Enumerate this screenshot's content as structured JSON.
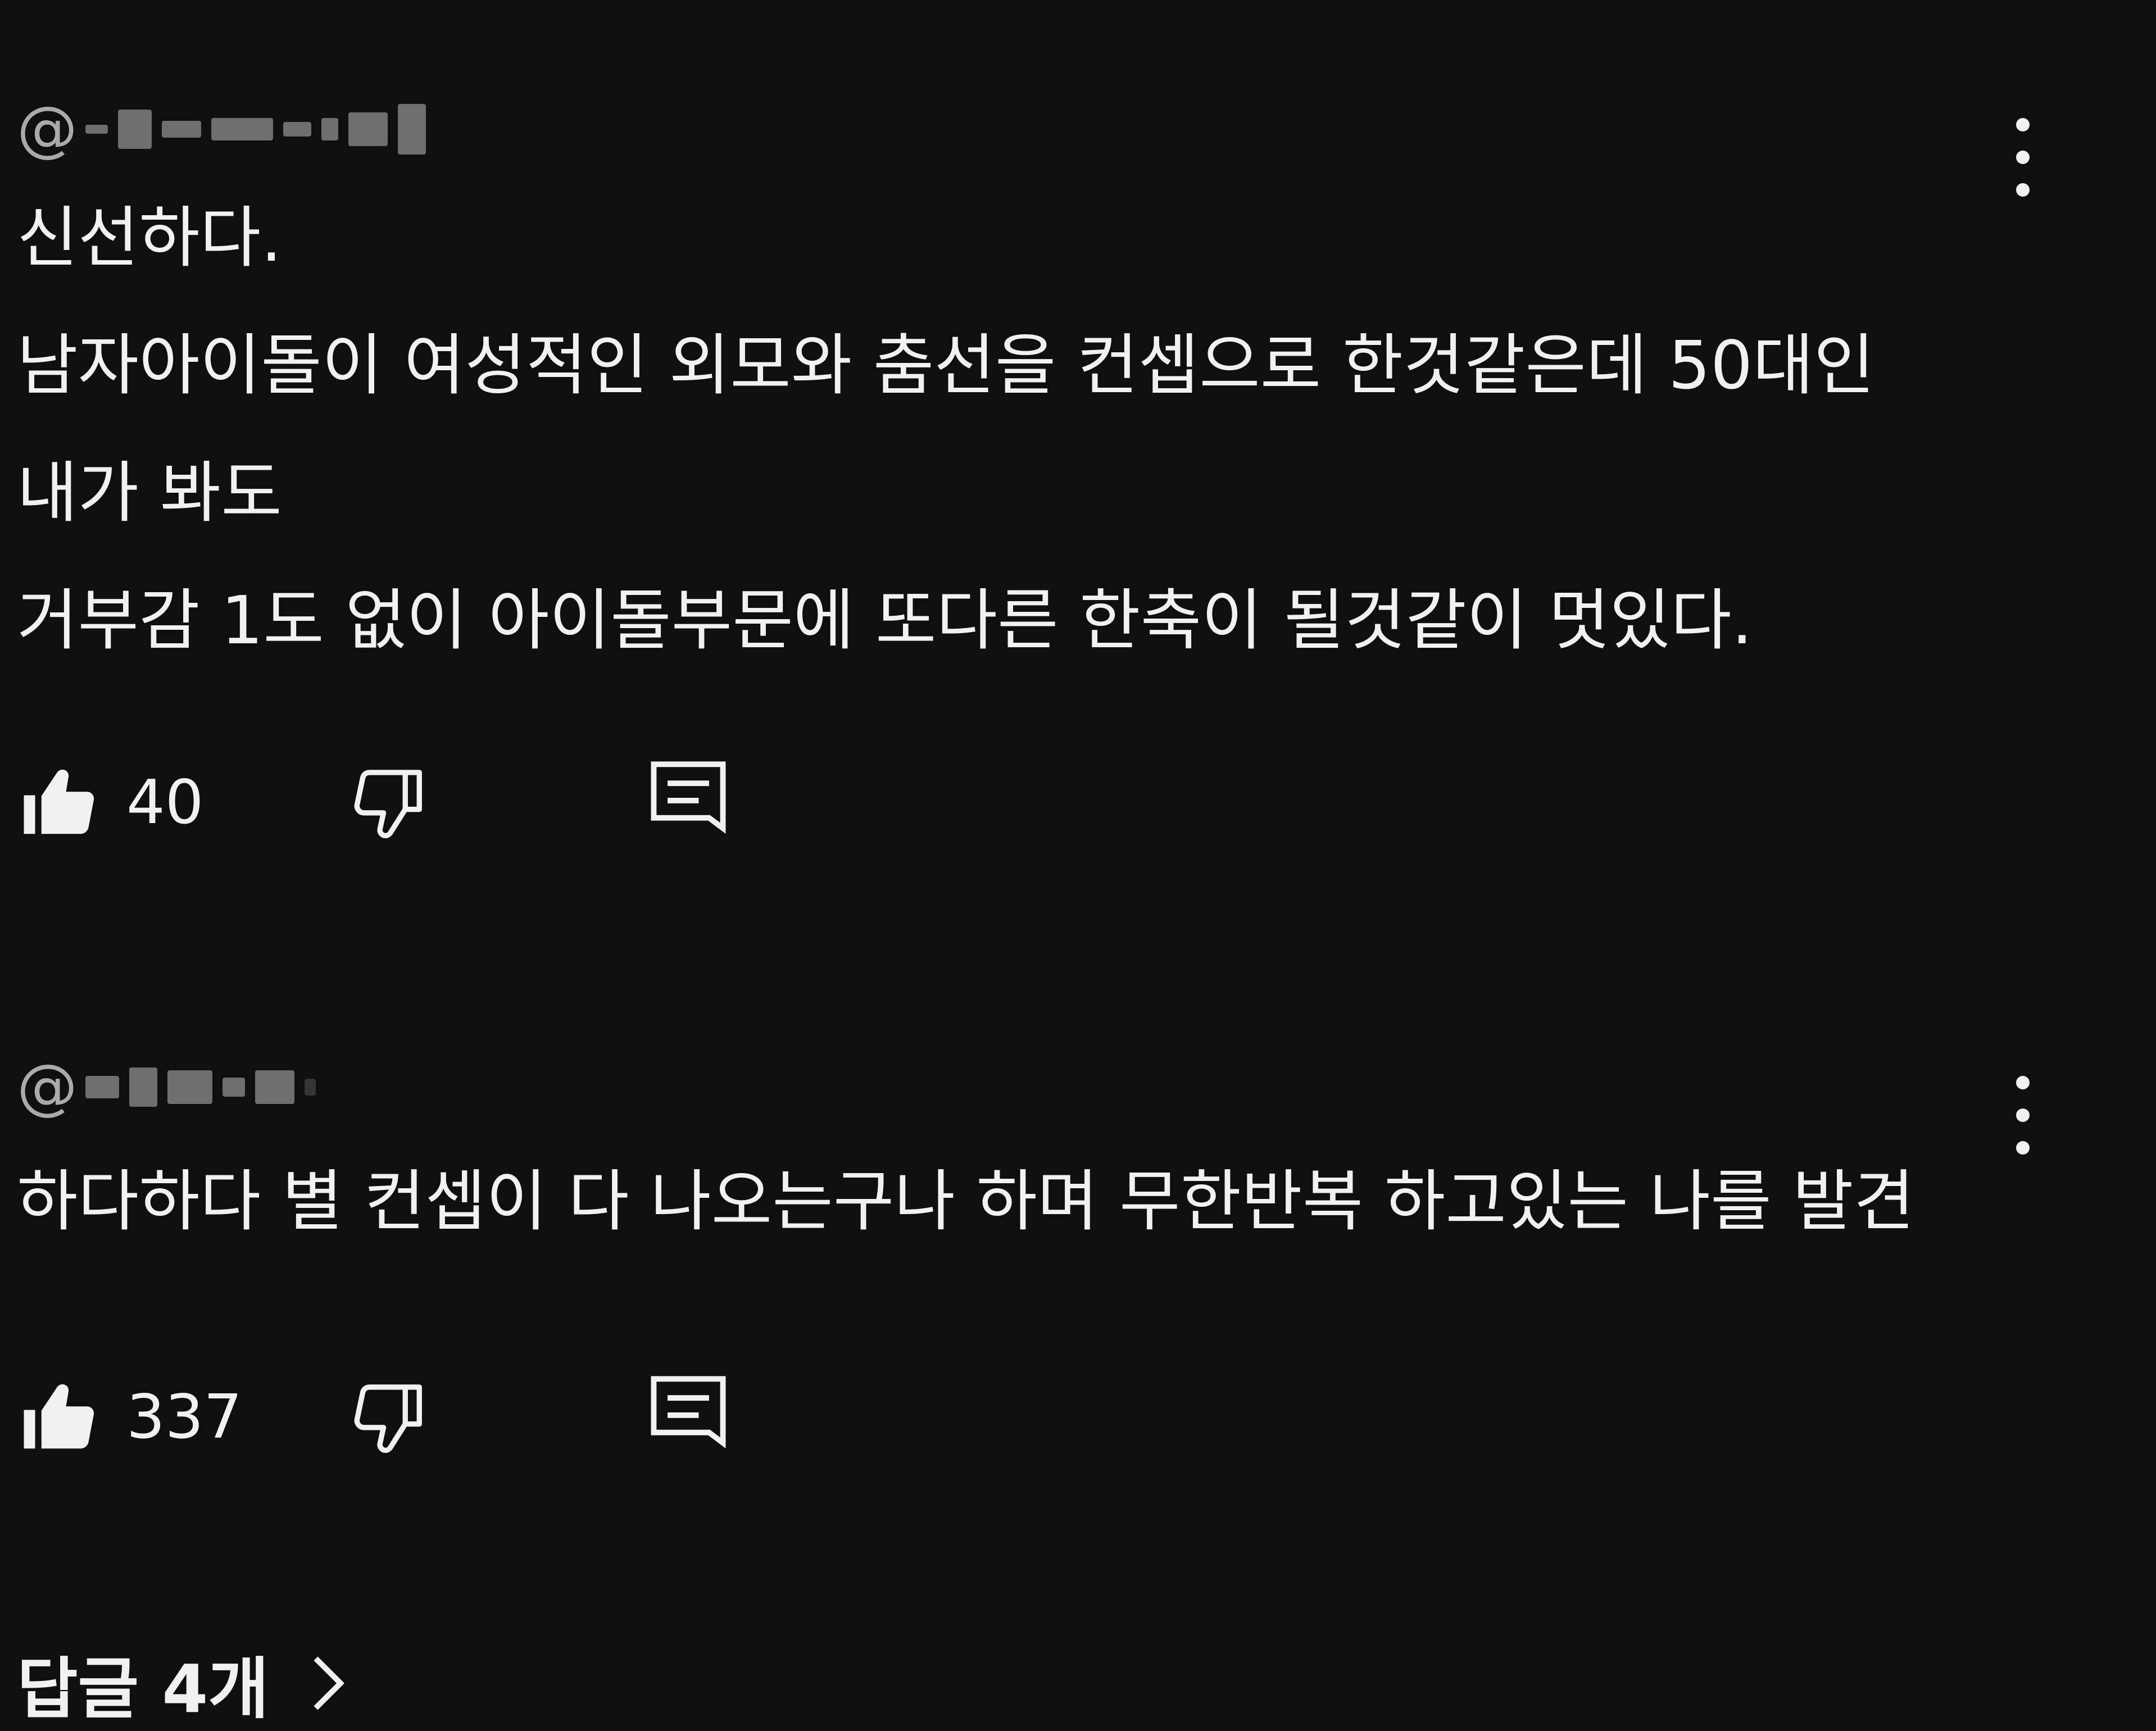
{
  "comments": [
    {
      "author_prefix": "@",
      "lines": [
        "신선하다.",
        "남자아이돌이 여성적인 외모와 춤선을 컨셉으로 한것같은데 50대인",
        "내가 봐도",
        "거부감 1도 없이 아이돌부문에 또다른 한축이 될것같이 멋있다."
      ],
      "like_count": "40"
    },
    {
      "author_prefix": "@",
      "lines": [
        "하다하다 별 컨셉이 다 나오는구나 하며 무한반복 하고있는 나를 발견"
      ],
      "like_count": "337"
    }
  ],
  "replies_link": "답글 4개",
  "icons": {
    "like": "thumbs-up-icon",
    "dislike": "thumbs-down-icon",
    "reply": "comment-reply-icon",
    "more": "more-vertical-icon",
    "chevron": "chevron-right-icon"
  }
}
